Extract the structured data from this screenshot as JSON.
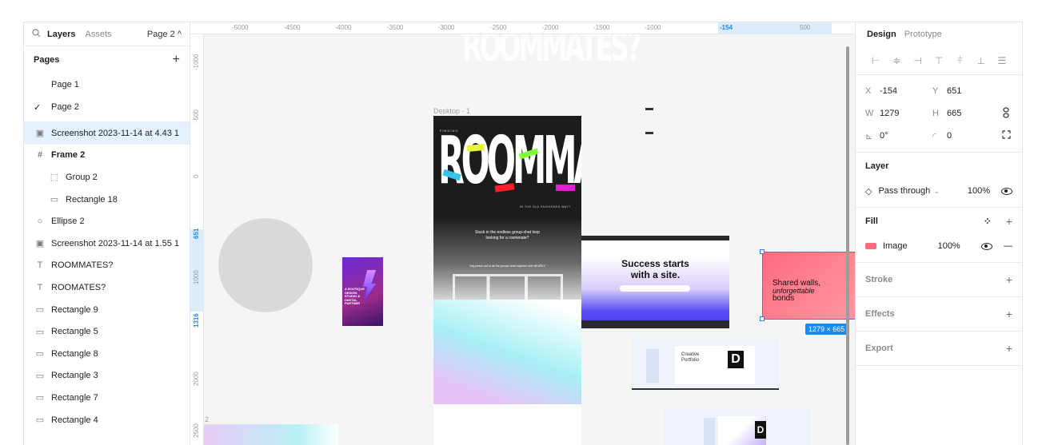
{
  "left_panel": {
    "tab_layers": "Layers",
    "tab_assets": "Assets",
    "page_selector": "Page 2 ^",
    "pages_title": "Pages",
    "add_page": "+",
    "pages": [
      "Page 1",
      "Page 2"
    ],
    "current_page_check": "✓",
    "layers": [
      {
        "icon": "▣",
        "label": "Screenshot 2023-11-14 at 4.43 1"
      },
      {
        "icon": "#",
        "label": "Frame 2"
      },
      {
        "icon": "⬚",
        "label": "Group 2"
      },
      {
        "icon": "▭",
        "label": "Rectangle 18"
      },
      {
        "icon": "○",
        "label": "Ellipse 2"
      },
      {
        "icon": "▣",
        "label": "Screenshot 2023-11-14 at 1.55 1"
      },
      {
        "icon": "T",
        "label": "ROOMMATES?"
      },
      {
        "icon": "T",
        "label": "ROOMATES?"
      },
      {
        "icon": "▭",
        "label": "Rectangle 9"
      },
      {
        "icon": "▭",
        "label": "Rectangle 5"
      },
      {
        "icon": "▭",
        "label": "Rectangle 8"
      },
      {
        "icon": "▭",
        "label": "Rectangle 3"
      },
      {
        "icon": "▭",
        "label": "Rectangle 7"
      },
      {
        "icon": "▭",
        "label": "Rectangle 4"
      }
    ]
  },
  "ruler_top": [
    "-5000",
    "-4500",
    "-4000",
    "-3500",
    "-3000",
    "-2500",
    "-2000",
    "-1500",
    "-1000",
    "-154",
    "500"
  ],
  "ruler_left": [
    "-1000",
    "-500",
    "0",
    "651",
    "1000",
    "1316",
    "2000",
    "2500"
  ],
  "canvas": {
    "frame_label": "Desktop - 1",
    "hero_big_text": "ROOMMATES?",
    "hero_small_top": "FINDING",
    "hero_tagline": "IN THE OLD FASHIONED WAY?",
    "hero_body_1": "Stuck in the endless group-chat loop",
    "hero_body_2": "looking for a roommate?",
    "hero_body_3": "Say peace out to all the groups chat mayhem with NEARLY",
    "success_line1": "Success starts",
    "success_line2": "with a site.",
    "pink_line1": "Shared walls,",
    "pink_line2": "unforgettable",
    "pink_line3": "bonds",
    "purple_card_text": "A BOUTIQUE DESIGN STUDIO & DIGITAL PARTNER",
    "portfolio_label": "Creative Portfolio",
    "size_badge": "1279 × 665",
    "frame2_label": "2"
  },
  "right_panel": {
    "tab_design": "Design",
    "tab_prototype": "Prototype",
    "align_icons": [
      "⊢",
      "≑",
      "⊣",
      "⊤",
      "⫩",
      "⊥",
      "☰"
    ],
    "x_label": "X",
    "x_value": "-154",
    "y_label": "Y",
    "y_value": "651",
    "w_label": "W",
    "w_value": "1279",
    "h_label": "H",
    "h_value": "665",
    "rotation_label": "⊾",
    "rotation_value": "0°",
    "radius_label": "◜",
    "radius_value": "0",
    "layer_title": "Layer",
    "blend_mode": "Pass through",
    "layer_opacity": "100%",
    "fill_title": "Fill",
    "fill_type": "Image",
    "fill_opacity": "100%",
    "stroke_title": "Stroke",
    "effects_title": "Effects",
    "export_title": "Export",
    "plus": "+",
    "minus": "—",
    "fill_swatch_color": "#ff6b7e"
  },
  "colors": {
    "selection": "#1a8bf0",
    "layer_selected_bg": "#e5f1fc"
  }
}
